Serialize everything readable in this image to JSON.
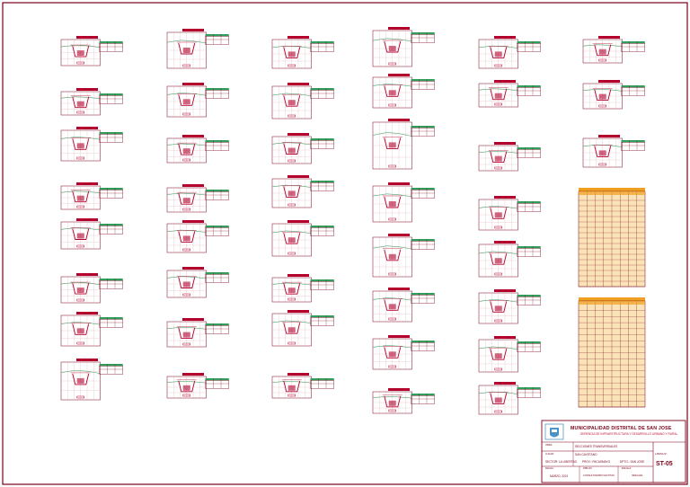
{
  "title_block": {
    "institution": "MUNICIPALIDAD DISTRITAL DE SAN JOSE",
    "department": "GERENCIA DE INFRAESTRUCTURA Y DESARROLLO URBANO Y RURAL",
    "field_project": "OBRA:",
    "sheet_title": "SECCIONES TRANSVERSALES",
    "field_location": "LUGAR:",
    "location": "SAN CAYETANO",
    "sector": "SECTOR: LA LIBERTAD",
    "province": "PROV.: PACASMAYO",
    "department_name": "DPTO.: SAN JOSE",
    "field_date": "FECHA:",
    "date": "MARZO, 2021",
    "field_drawn": "DIBUJO:",
    "drawn_by": "CONSULTOR/PROYECTISTA",
    "field_scale": "ESCALA:",
    "scale": "INDICADA",
    "field_sheet": "LAMINA Nº:",
    "sheet_number": "ST-05"
  },
  "palette": {
    "border": "#7a0019",
    "section": "#b3002d",
    "header_green": "#2f9e5b",
    "table_fill": "#f0a020",
    "logo": "#1f78b4"
  },
  "volume_tables": [
    {
      "header": "CUADRO DE VOLUMENES",
      "rows": 17
    },
    {
      "header": "CUADRO DE VOLUMENES",
      "rows": 17
    }
  ]
}
